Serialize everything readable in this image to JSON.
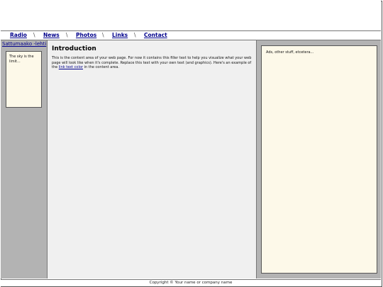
{
  "nav": {
    "items": [
      {
        "label": "Radio"
      },
      {
        "label": "News"
      },
      {
        "label": "Photos"
      },
      {
        "label": "Links"
      },
      {
        "label": "Contact"
      }
    ],
    "separator": "\\"
  },
  "sidebar_left": {
    "site_link": "Sattumaako -lehti",
    "box_text": "The sky is the limit..."
  },
  "content": {
    "title": "Introduction",
    "body_before_link": "This is the content area of your web page. For now it contains this filler text to help you visualize what your web page will look like when it's complete. Replace this text with your own text (and graphics). Here's an example of the ",
    "link_text": "link text color",
    "body_after_link": " in the content area."
  },
  "sidebar_right": {
    "box_text": "Ads, other stuff, etcetera..."
  },
  "footer": {
    "copyright": "Copyright © Your name or company name"
  },
  "colors": {
    "link": "#00008b",
    "side_bg": "#b3b3b3",
    "content_bg": "#f0f0f0",
    "box_bg": "#fdf9e9"
  }
}
